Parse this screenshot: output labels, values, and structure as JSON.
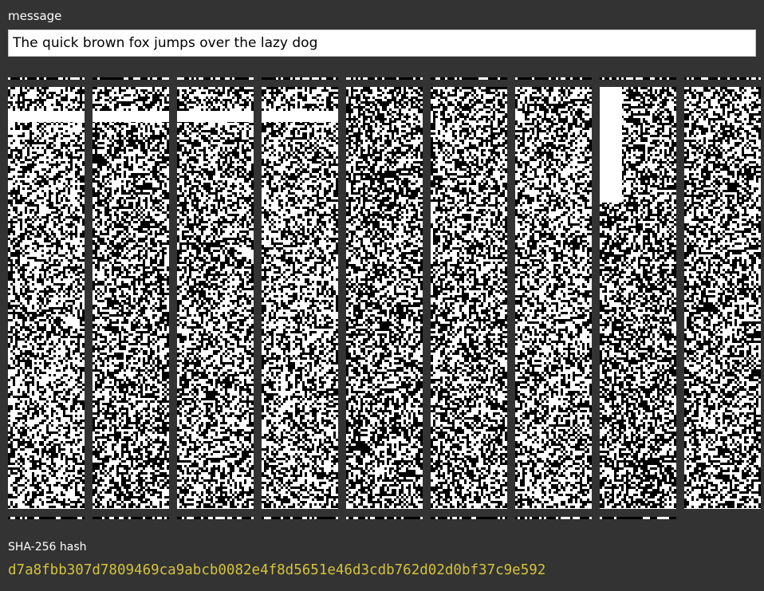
{
  "message": {
    "label": "message",
    "value": "The quick brown fox jumps over the lazy dog"
  },
  "visualization": {
    "description": "",
    "column_count": 9,
    "foreground": "#000000",
    "background": "#ffffff",
    "gap_color": "#333333"
  },
  "hash": {
    "label": "SHA-256 hash",
    "value": "d7a8fbb307d7809469ca9abcb0082e4f8d5651e46d3cdb762d02d0bf37c9e592",
    "color": "#d4c23c"
  }
}
